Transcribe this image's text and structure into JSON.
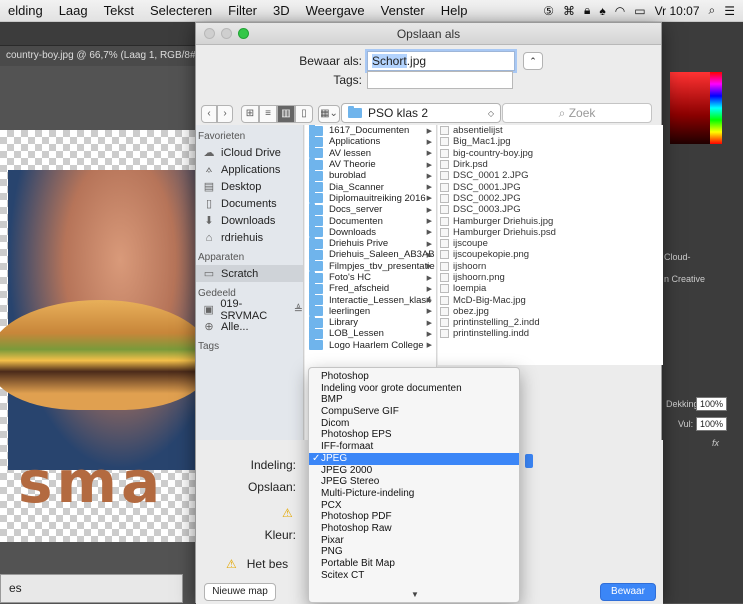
{
  "menubar": {
    "items": [
      "elding",
      "Laag",
      "Tekst",
      "Selecteren",
      "Filter",
      "3D",
      "Weergave",
      "Venster",
      "Help"
    ],
    "clock": "Vr 10:07"
  },
  "photoshop": {
    "doc_tab": "country-boy.jpg @ 66,7% (Laag 1, RGB/8#) *",
    "canvas_text": "sma",
    "panel_texts": [
      "Cloud-",
      "n Creative"
    ],
    "dekking_label": "Dekking:",
    "dekking_value": "100%",
    "vul_label": "Vul:",
    "vul_value": "100%",
    "fx": "fx",
    "bottom_panel_label": "es"
  },
  "dialog": {
    "title": "Opslaan als",
    "save_as_label": "Bewaar als:",
    "save_as_value": "Schort",
    "save_as_ext": ".jpg",
    "tags_label": "Tags:",
    "path": "PSO klas 2",
    "search_placeholder": "Zoek",
    "sidebar": {
      "favorites_header": "Favorieten",
      "favorites": [
        {
          "label": "iCloud Drive",
          "icon": "☁"
        },
        {
          "label": "Applications",
          "icon": "⟑"
        },
        {
          "label": "Desktop",
          "icon": "▤"
        },
        {
          "label": "Documents",
          "icon": "▯"
        },
        {
          "label": "Downloads",
          "icon": "⬇"
        },
        {
          "label": "rdriehuis",
          "icon": "⌂"
        }
      ],
      "devices_header": "Apparaten",
      "devices": [
        {
          "label": "Scratch",
          "icon": "▭"
        }
      ],
      "shared_header": "Gedeeld",
      "shared": [
        {
          "label": "019-SRVMAC",
          "icon": "▣",
          "eject": "≜"
        },
        {
          "label": "Alle...",
          "icon": "⊕"
        }
      ],
      "tags_header": "Tags"
    },
    "folders": [
      "1617_Documenten",
      "Applications",
      "AV lessen",
      "AV Theorie",
      "buroblad",
      "Dia_Scanner",
      "Diplomauitreiking 2016",
      "Docs_server",
      "Documenten",
      "Downloads",
      "Driehuis Prive",
      "Driehuis_Saleen_AB3AB",
      "Filmpjes_tbv_presentatie",
      "Foto's HC",
      "Fred_afscheid",
      "Interactie_Lessen_klas4",
      "leerlingen",
      "Library",
      "LOB_Lessen",
      "Logo Haarlem College"
    ],
    "files": [
      "absentielijst",
      "Big_Mac1.jpg",
      "big-country-boy.jpg",
      "Dirk.psd",
      "DSC_0001 2.JPG",
      "DSC_0001.JPG",
      "DSC_0002.JPG",
      "DSC_0003.JPG",
      "Hamburger Driehuis.jpg",
      "Hamburger Driehuis.psd",
      "ijscoupe",
      "ijscoupekopie.png",
      "ijshoorn",
      "ijshoorn.png",
      "loempia",
      "McD-Big-Mac.jpg",
      "obez.jpg",
      "printinstelling_2.indd",
      "printinstelling.indd"
    ],
    "format_label": "Indeling:",
    "save_label": "Opslaan:",
    "color_label": "Kleur:",
    "warning_text": "Het bes",
    "format_options": [
      "Photoshop",
      "Indeling voor grote documenten",
      "BMP",
      "CompuServe GIF",
      "Dicom",
      "Photoshop EPS",
      "IFF-formaat",
      "JPEG",
      "JPEG 2000",
      "JPEG Stereo",
      "Multi-Picture-indeling",
      "PCX",
      "Photoshop PDF",
      "Photoshop Raw",
      "Pixar",
      "PNG",
      "Portable Bit Map",
      "Scitex CT"
    ],
    "selected_format": "JPEG",
    "checkmark": "✓",
    "new_folder_button": "Nieuwe map",
    "save_button": "Bewaar"
  }
}
